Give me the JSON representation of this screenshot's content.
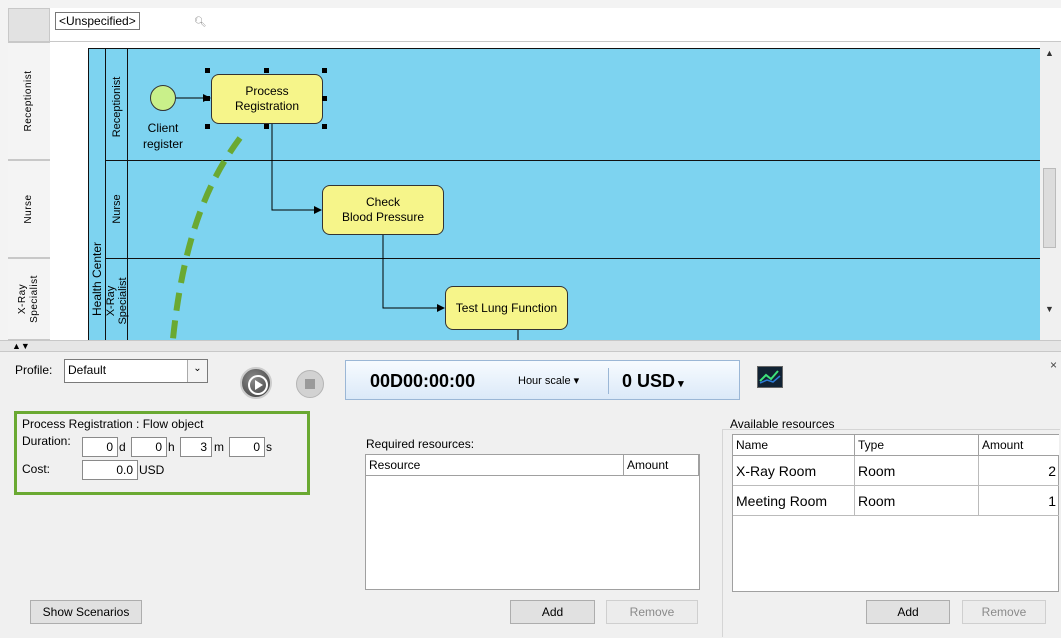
{
  "diagram": {
    "context_tag": "<Unspecified>",
    "lane_headers": [
      "Receptionist",
      "Nurse",
      "X-Ray\nSpecialist"
    ],
    "pool_label": "Health Center",
    "lanes": [
      "Receptionist",
      "Nurse",
      "X-Ray\nSpecialist"
    ],
    "start_event_label": "Client\nregister",
    "tasks": {
      "process_registration": "Process\nRegistration",
      "check_blood_pressure": "Check\nBlood Pressure",
      "test_lung_function": "Test Lung Function"
    },
    "colors": {
      "pool": "#7dd3f0",
      "task": "#f6f58a",
      "start_event": "#c9f08a",
      "highlight": "#6aa932"
    }
  },
  "panel": {
    "profile_label": "Profile:",
    "profile_value": "Default",
    "timer": "00D00:00:00",
    "hour_scale": "Hour scale",
    "cost_total": "0  USD",
    "selected_title": "Process Registration : Flow object",
    "duration_label": "Duration:",
    "duration": {
      "d": "0",
      "h": "0",
      "m": "3",
      "s": "0"
    },
    "duration_units": {
      "d": "d",
      "h": "h",
      "m": "m",
      "s": "s"
    },
    "cost_label": "Cost:",
    "cost_value": "0.0",
    "cost_unit": "USD",
    "show_scenarios": "Show Scenarios",
    "required_resources": {
      "title": "Required resources:",
      "columns": [
        "Resource",
        "Amount"
      ],
      "add": "Add",
      "remove": "Remove"
    },
    "available_resources": {
      "title": "Available resources",
      "columns": [
        "Name",
        "Type",
        "Amount"
      ],
      "rows": [
        {
          "name": "X-Ray Room",
          "type": "Room",
          "amount": "2"
        },
        {
          "name": "Meeting Room",
          "type": "Room",
          "amount": "1"
        }
      ],
      "add": "Add",
      "remove": "Remove"
    }
  }
}
